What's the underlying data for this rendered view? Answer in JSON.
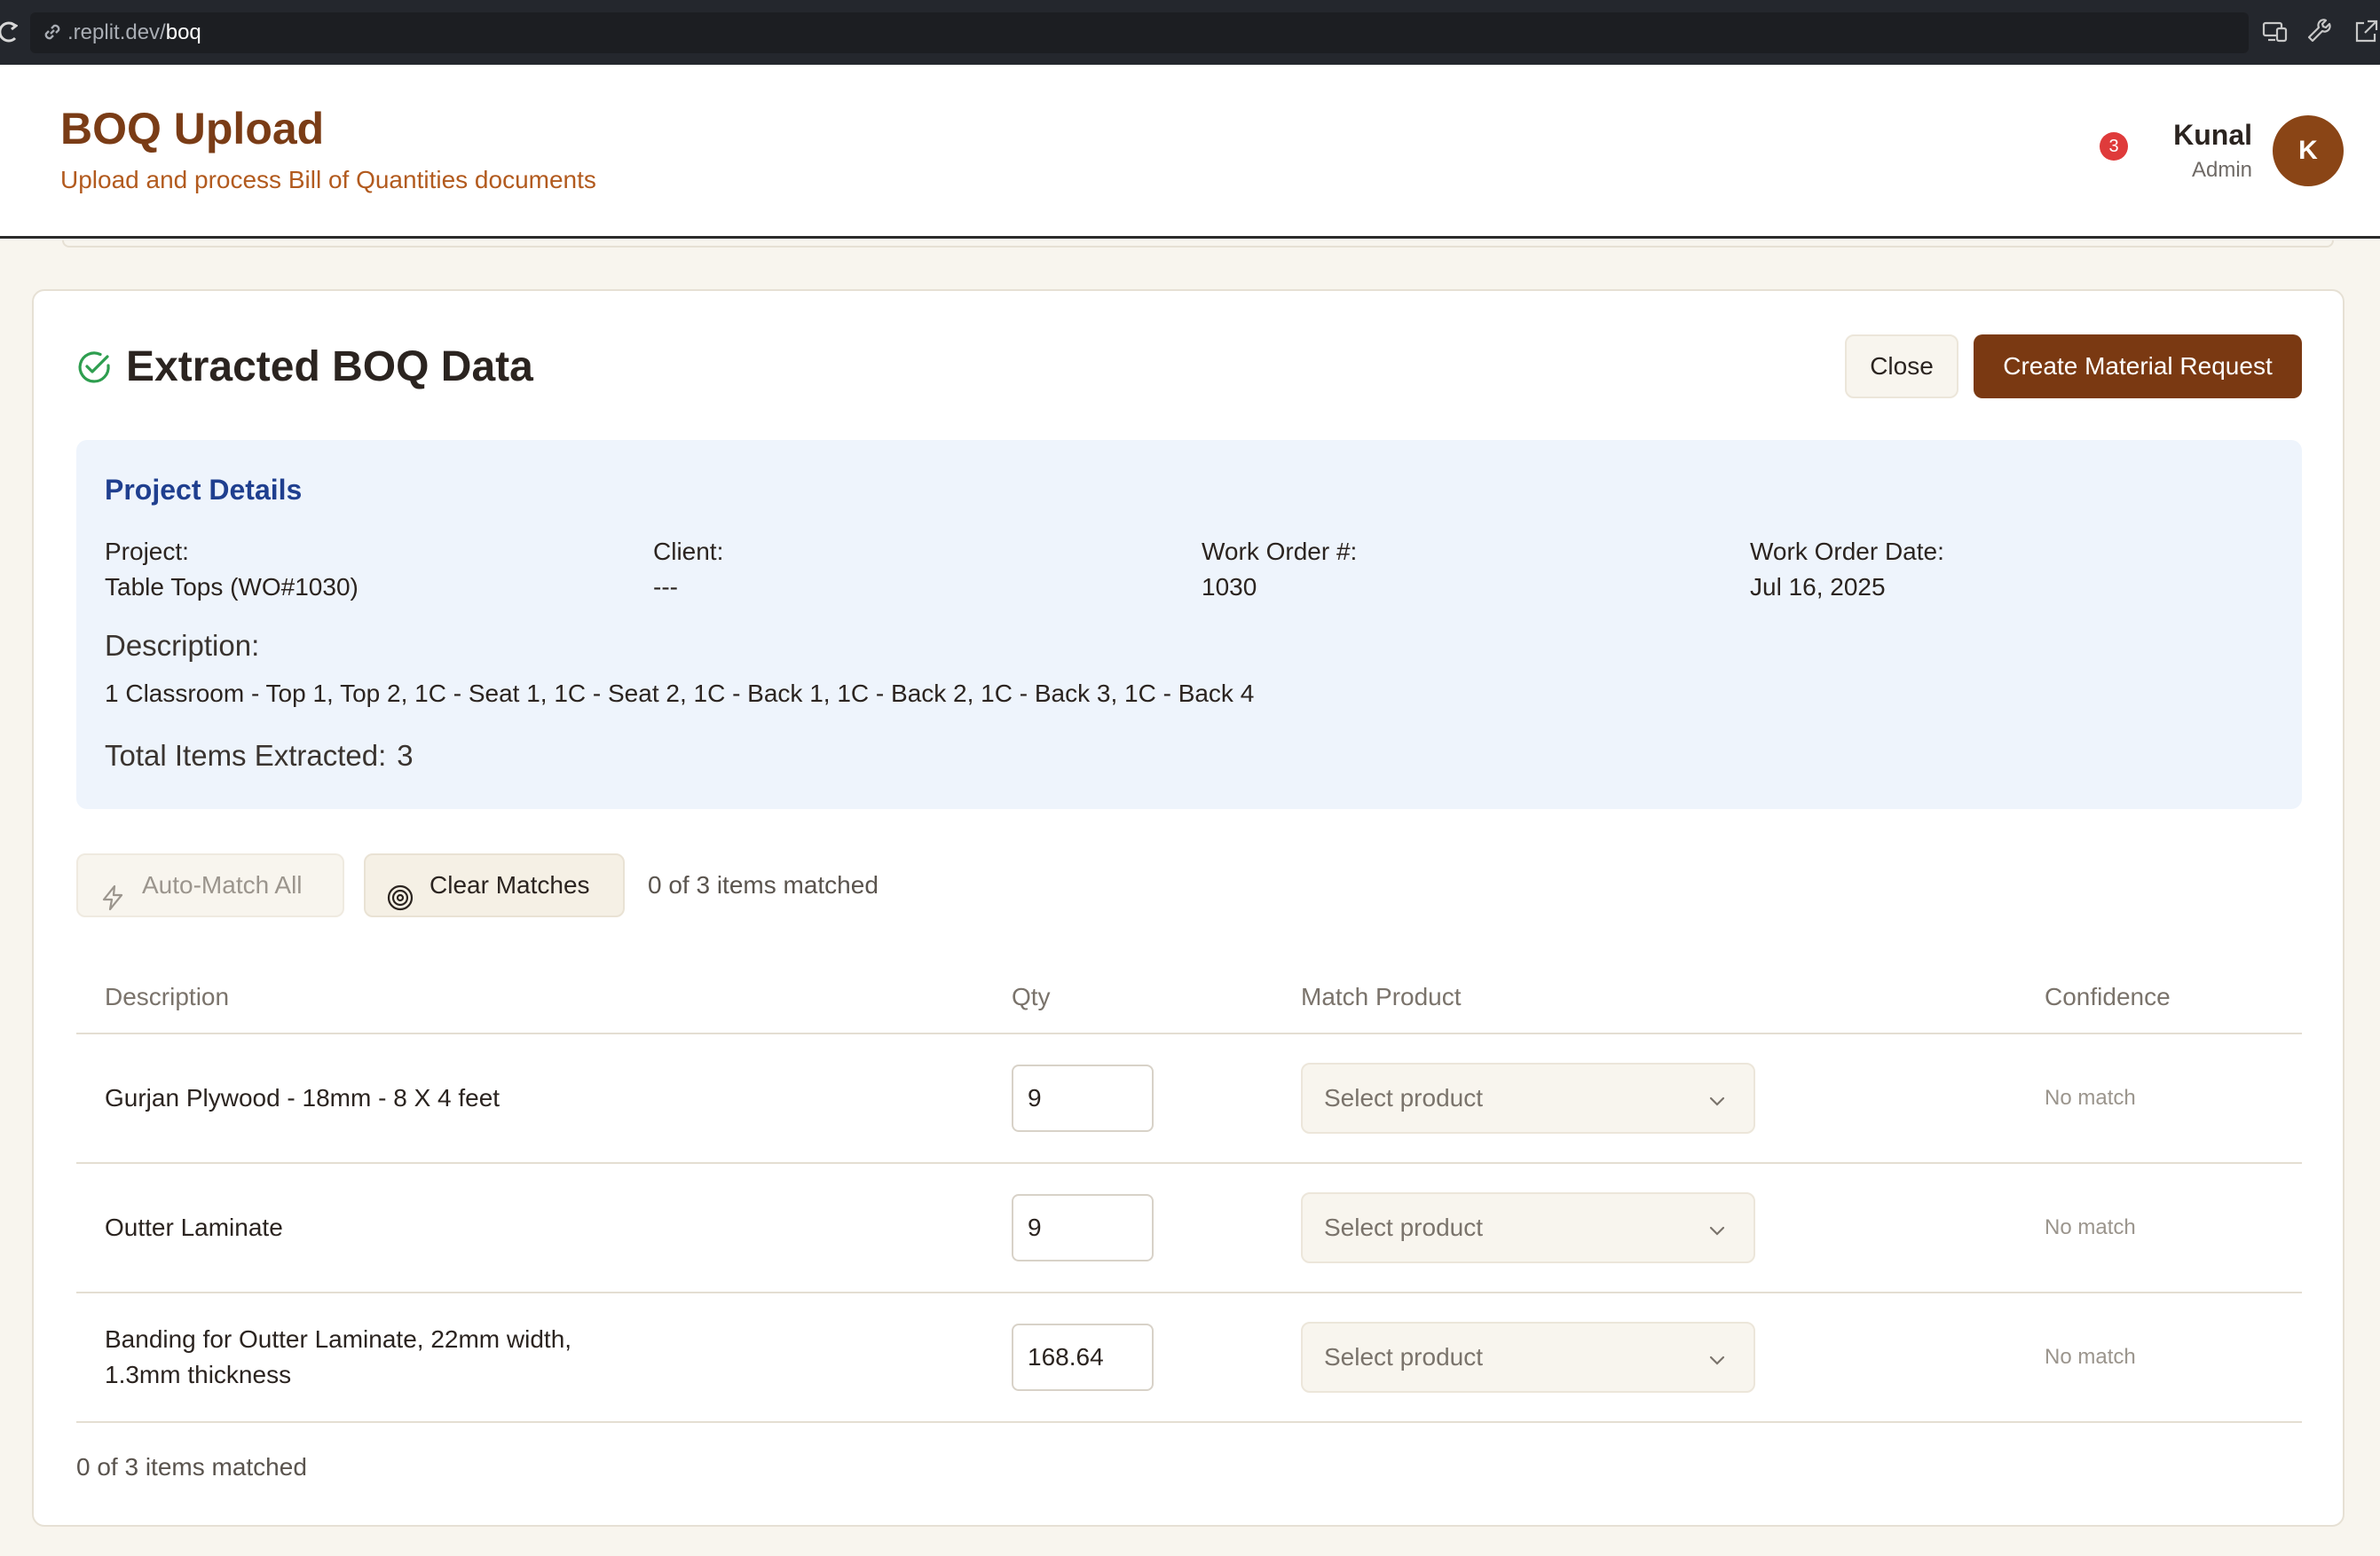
{
  "browser": {
    "url_prefix": ".replit.dev/",
    "url_path": "boq"
  },
  "header": {
    "title": "BOQ Upload",
    "subtitle": "Upload and process Bill of Quantities documents",
    "notification_count": "3",
    "user_name": "Kunal",
    "user_role": "Admin",
    "avatar_initial": "K"
  },
  "card": {
    "title": "Extracted BOQ Data",
    "close_label": "Close",
    "create_label": "Create Material Request"
  },
  "project": {
    "heading": "Project Details",
    "fields": [
      {
        "label": "Project:",
        "value": "Table Tops (WO#1030)"
      },
      {
        "label": "Client:",
        "value": "---"
      },
      {
        "label": "Work Order #:",
        "value": "1030"
      },
      {
        "label": "Work Order Date:",
        "value": "Jul 16, 2025"
      }
    ],
    "description_label": "Description:",
    "description": "1 Classroom - Top 1, Top 2, 1C - Seat 1, 1C - Seat 2, 1C - Back 1, 1C - Back 2, 1C - Back 3, 1C - Back 4",
    "total_label": "Total Items Extracted:",
    "total_value": "3"
  },
  "actions": {
    "auto_match_label": "Auto-Match All",
    "clear_matches_label": "Clear Matches",
    "match_status": "0 of 3 items matched"
  },
  "table": {
    "headers": [
      "Description",
      "Qty",
      "Match Product",
      "Confidence"
    ],
    "rows": [
      {
        "description": "Gurjan Plywood - 18mm - 8 X 4 feet",
        "qty": "9",
        "product_placeholder": "Select product",
        "confidence": "No match"
      },
      {
        "description": "Outter Laminate",
        "qty": "9",
        "product_placeholder": "Select product",
        "confidence": "No match"
      },
      {
        "description": "Banding for Outter Laminate, 22mm width, 1.3mm thickness",
        "qty": "168.64",
        "product_placeholder": "Select product",
        "confidence": "No match"
      }
    ]
  },
  "footer": {
    "match_status": "0 of 3 items matched"
  },
  "colors": {
    "brand": "#7a3912",
    "title": "#7a3c16",
    "panel_bg": "#eef4fc",
    "panel_heading": "#1f3f8f",
    "success": "#2e9e4f",
    "badge": "#df3b3b"
  },
  "icons": {
    "reload": "reload-icon",
    "link": "link-icon",
    "title_status": "check-circle-icon",
    "auto_match": "lightning-icon",
    "clear_matches": "target-icon",
    "select": "chevron-down-icon"
  }
}
